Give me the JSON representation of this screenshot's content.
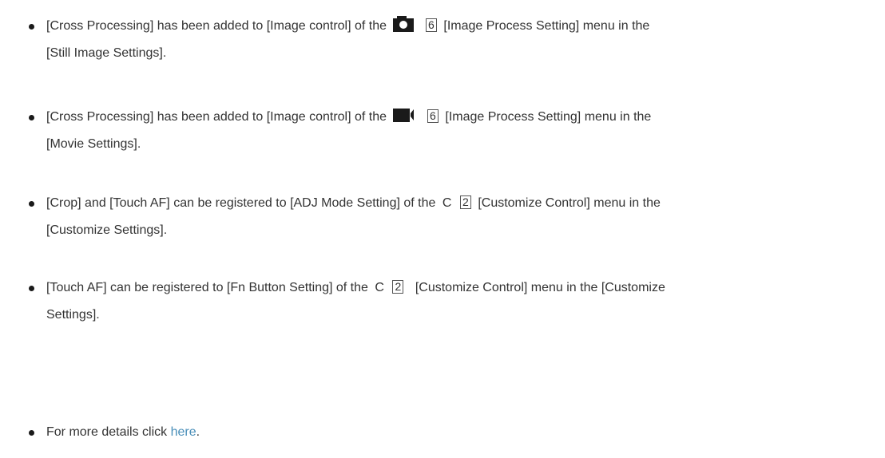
{
  "items": [
    {
      "part1": "[Cross Processing] has been added to [Image control] of the",
      "icon": "camera-icon",
      "num": "6",
      "part2": "[Image Process Setting] menu in the",
      "line2": "[Still Image Settings]."
    },
    {
      "part1": "[Cross Processing] has been added to [Image control] of the",
      "icon": "movie-camera-icon",
      "num": "6",
      "part2": "[Image Process Setting] menu in the",
      "line2": "[Movie Settings]."
    },
    {
      "part1": "[Crop] and [Touch AF] can be registered to [ADJ Mode Setting] of the",
      "letter": "C",
      "num": "2",
      "part2": "[Customize Control] menu in the",
      "line2": "[Customize Settings]."
    },
    {
      "part1": "[Touch AF] can be registered to [Fn Button Setting] of the",
      "letter": "C",
      "num": "2",
      "part2": "[Customize Control] menu in the [Customize",
      "line2": "Settings]."
    }
  ],
  "details": {
    "prefix": "For more details click",
    "link": "here",
    "suffix": "."
  },
  "colors": {
    "text": "#333333",
    "link": "#4a8fb9",
    "bullet": "#1a1a1a"
  }
}
